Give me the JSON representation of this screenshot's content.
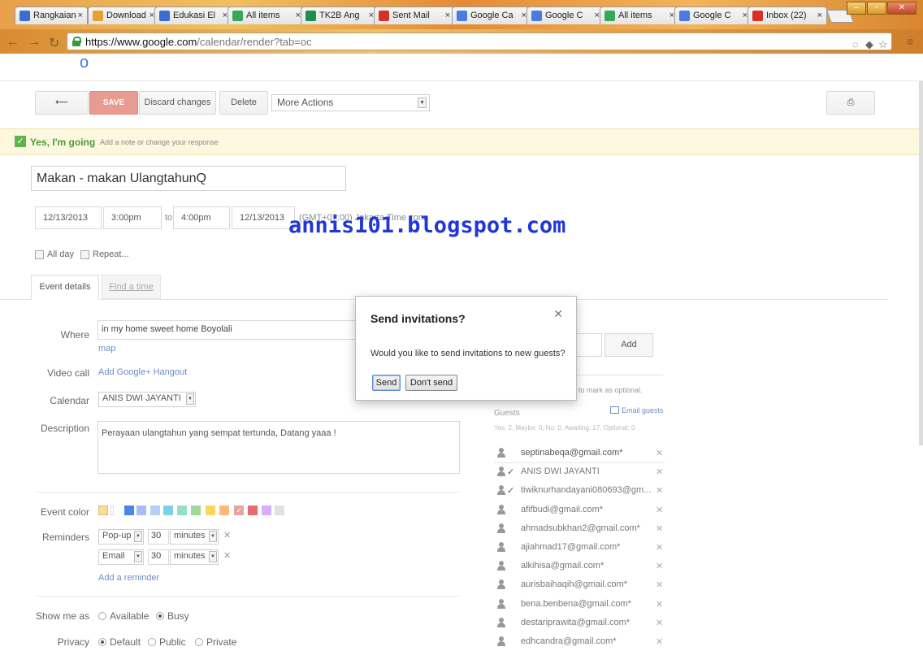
{
  "browser": {
    "tabs": [
      {
        "label": "Rangkaian",
        "icon": "ie-icon",
        "color": "#3b6fcf"
      },
      {
        "label": "Download",
        "icon": "download-icon",
        "color": "#e8a030"
      },
      {
        "label": "Edukasi El",
        "icon": "ie-icon",
        "color": "#3b6fcf"
      },
      {
        "label": "All items",
        "icon": "drive-icon",
        "color": "#3aa757"
      },
      {
        "label": "TK2B Ang",
        "icon": "sheets-icon",
        "color": "#1f8f4c"
      },
      {
        "label": "Sent Mail",
        "icon": "gmail-icon",
        "color": "#d93025"
      },
      {
        "label": "Google Ca",
        "icon": "calendar-icon",
        "color": "#4a7ce0"
      },
      {
        "label": "Google C",
        "icon": "calendar-icon",
        "color": "#4a7ce0"
      },
      {
        "label": "All items",
        "icon": "drive-icon",
        "color": "#3aa757"
      },
      {
        "label": "Google C",
        "icon": "calendar-icon",
        "color": "#4a7ce0"
      },
      {
        "label": "Inbox (22)",
        "icon": "gmail-icon",
        "color": "#d93025"
      }
    ],
    "url_host": "https://www.google.com",
    "url_path": "/calendar/render?tab=oc"
  },
  "toolbar": {
    "save_label": "SAVE",
    "discard_label": "Discard changes",
    "delete_label": "Delete",
    "more_actions_label": "More Actions"
  },
  "rsvp": {
    "going_label": "Yes, I'm going",
    "note_label": "Add a note or change your response"
  },
  "event": {
    "title": "Makan - makan UlangtahunQ",
    "start_date": "12/13/2013",
    "start_time": "3:00pm",
    "to_label": "to",
    "end_time": "4:00pm",
    "end_date": "12/13/2013",
    "timezone": "(GMT+07:00) Jakarta",
    "timezone_suffix": "Time zone",
    "all_day_label": "All day",
    "repeat_label": "Repeat..."
  },
  "watermark": "annis101.blogspot.com",
  "tabs": {
    "event_details": "Event details",
    "find_a_time": "Find a time"
  },
  "details": {
    "where_label": "Where",
    "where_value": "in my home sweet home Boyolali",
    "map_link": "map",
    "video_call_label": "Video call",
    "hangout_link": "Add Google+ Hangout",
    "calendar_label": "Calendar",
    "calendar_value": "ANIS DWI JAYANTI",
    "description_label": "Description",
    "description_value": "Perayaan ulangtahun yang sempat tertunda, Datang yaaa !",
    "event_color_label": "Event color",
    "reminders_label": "Reminders",
    "reminders": [
      {
        "type": "Pop-up",
        "amount": "30",
        "unit": "minutes"
      },
      {
        "type": "Email",
        "amount": "30",
        "unit": "minutes"
      }
    ],
    "add_reminder_link": "Add a reminder",
    "show_me_as_label": "Show me as",
    "available_label": "Available",
    "busy_label": "Busy",
    "privacy_label": "Privacy",
    "default_label": "Default",
    "public_label": "Public",
    "private_label": "Private"
  },
  "colors": {
    "swatches": [
      "#f8dc9a",
      "#ffffff",
      "#4a86e8",
      "#a4bdfc",
      "#b6cff5",
      "#7bd2e6",
      "#92e1c0",
      "#9fd89a",
      "#fbd75b",
      "#ffb878",
      "#e8a49a",
      "#e66b6b",
      "#dbadff",
      "#e1e1e1"
    ],
    "accent_green": "#5fb34a",
    "save_red": "#e79b91"
  },
  "guests": {
    "placeholder_fragment": "es",
    "add_label": "Add",
    "optional_hint": "to mark as optional.",
    "header_label": "Guests",
    "email_guests_label": "Email guests",
    "summary": "Yes: 2, Maybe: 0, No: 0, Awaiting: 17, Optional: 0",
    "list": [
      {
        "email": "septinabeqa@gmail.com*",
        "tick": ""
      },
      {
        "email": "ANIS DWI JAYANTI",
        "tick": "✓"
      },
      {
        "email": "tiwiknurhandayani080693@gm...",
        "tick": "✓"
      },
      {
        "email": "afifbudi@gmail.com*",
        "tick": ""
      },
      {
        "email": "ahmadsubkhan2@gmail.com*",
        "tick": ""
      },
      {
        "email": "ajiahmad17@gmail.com*",
        "tick": ""
      },
      {
        "email": "alkihisa@gmail.com*",
        "tick": ""
      },
      {
        "email": "aurisbaihaqih@gmail.com*",
        "tick": ""
      },
      {
        "email": "bena.benbena@gmail.com*",
        "tick": ""
      },
      {
        "email": "destariprawita@gmail.com*",
        "tick": ""
      },
      {
        "email": "edhcandra@gmail.com*",
        "tick": ""
      }
    ]
  },
  "dialog": {
    "title": "Send invitations?",
    "message": "Would you like to send invitations to new guests?",
    "send_label": "Send",
    "dont_send_label": "Don't send"
  }
}
